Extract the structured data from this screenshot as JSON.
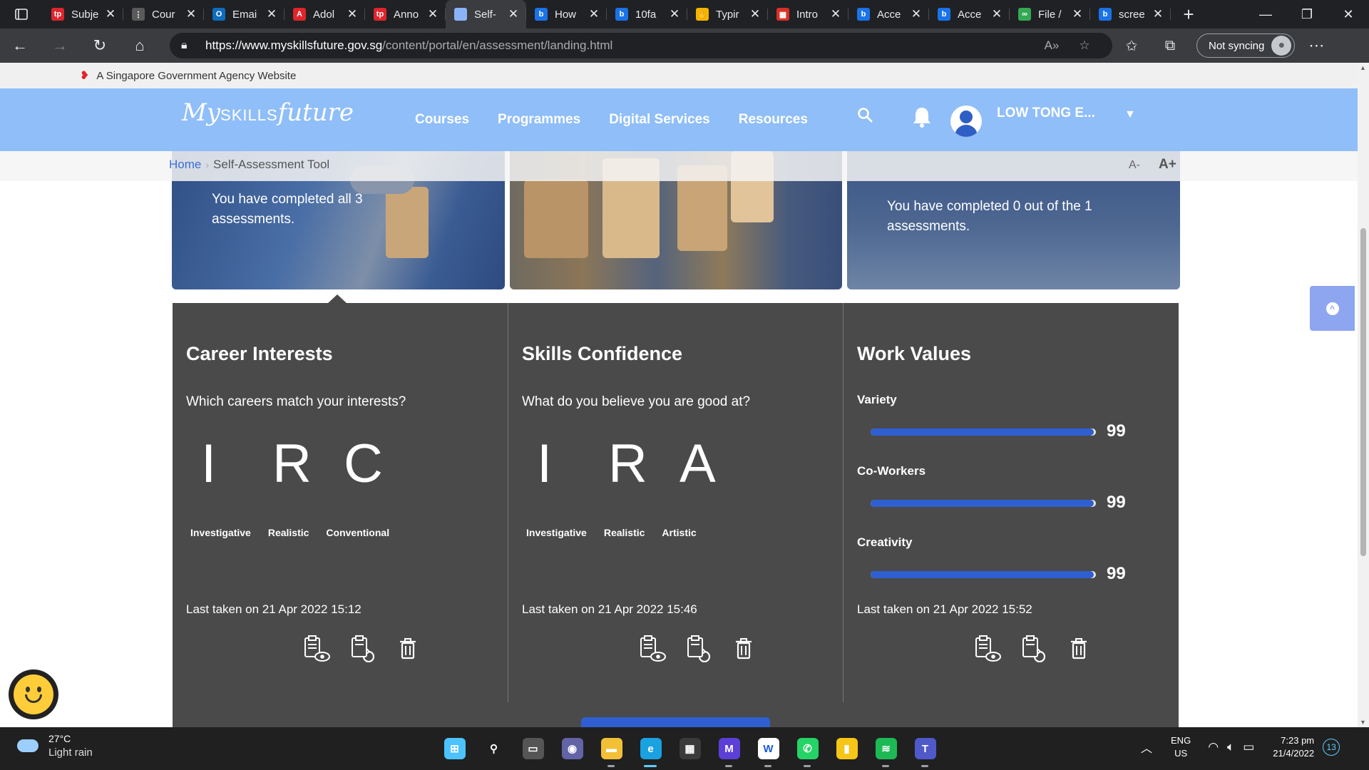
{
  "browser": {
    "tabs": [
      {
        "title": "Subje",
        "icon": "tp-icon",
        "color": "#e0242c",
        "glyph": "tp"
      },
      {
        "title": "Cour",
        "icon": "cisco-icon",
        "color": "#5a5a5a",
        "glyph": "⋮"
      },
      {
        "title": "Emai",
        "icon": "outlook-icon",
        "color": "#0f6cbd",
        "glyph": "O"
      },
      {
        "title": "Adol",
        "icon": "adobe-icon",
        "color": "#e0242c",
        "glyph": "A"
      },
      {
        "title": "Anno",
        "icon": "tp-icon",
        "color": "#e0242c",
        "glyph": "tp"
      },
      {
        "title": "Self-",
        "icon": "page-icon",
        "color": "#8ab4f8",
        "glyph": ""
      },
      {
        "title": "How",
        "icon": "bing-icon",
        "color": "#1a73e8",
        "glyph": "b"
      },
      {
        "title": "10fa",
        "icon": "bing-icon",
        "color": "#1a73e8",
        "glyph": "b"
      },
      {
        "title": "Typir",
        "icon": "typing-icon",
        "color": "#f4b400",
        "glyph": "✋"
      },
      {
        "title": "Intro",
        "icon": "cisco-icon",
        "color": "#d93025",
        "glyph": "▦"
      },
      {
        "title": "Acce",
        "icon": "bing-icon",
        "color": "#1a73e8",
        "glyph": "b"
      },
      {
        "title": "Acce",
        "icon": "bing-icon",
        "color": "#1a73e8",
        "glyph": "b"
      },
      {
        "title": "File /",
        "icon": "link-icon",
        "color": "#34a853",
        "glyph": "∞"
      },
      {
        "title": "scree",
        "icon": "bing-icon",
        "color": "#1a73e8",
        "glyph": "b"
      }
    ],
    "url_domain": "https://www.myskillsfuture.gov.sg",
    "url_path": "/content/portal/en/assessment/landing.html",
    "sync_label": "Not syncing"
  },
  "gov_banner": "A Singapore Government Agency Website",
  "header": {
    "logo_my": "My",
    "logo_skills": "SKILLS",
    "logo_future": "future",
    "nav": [
      "Courses",
      "Programmes",
      "Digital Services",
      "Resources"
    ],
    "user_name": "LOW TONG E..."
  },
  "breadcrumb": {
    "home": "Home",
    "current": "Self-Assessment Tool"
  },
  "font_controls": {
    "decrease": "A-",
    "increase": "A+"
  },
  "heroes": {
    "card1": "You have completed all 3 assessments.",
    "card3": "You have completed 0 out of the 1 assessments."
  },
  "assessments": {
    "career": {
      "title": "Career Interests",
      "question": "Which careers match your interests?",
      "letters": [
        "I",
        "R",
        "C"
      ],
      "traits": [
        "Investigative",
        "Realistic",
        "Conventional"
      ],
      "last_taken": "Last taken on 21 Apr 2022 15:12"
    },
    "skills": {
      "title": "Skills Confidence",
      "question": "What do you believe you are good at?",
      "letters": [
        "I",
        "R",
        "A"
      ],
      "traits": [
        "Investigative",
        "Realistic",
        "Artistic"
      ],
      "last_taken": "Last taken on 21 Apr 2022 15:46"
    },
    "values": {
      "title": "Work Values",
      "items": [
        {
          "label": "Variety",
          "score": "99",
          "fraction": 0.99
        },
        {
          "label": "Co-Workers",
          "score": "99",
          "fraction": 0.99
        },
        {
          "label": "Creativity",
          "score": "99",
          "fraction": 0.99
        }
      ],
      "last_taken": "Last taken on 21 Apr 2022 15:52"
    }
  },
  "colors": {
    "header_blue": "#8fbef8",
    "panel_bg": "#4a4a4a",
    "bar_fill": "#2f5fd0"
  },
  "taskbar": {
    "weather_temp": "27°C",
    "weather_desc": "Light rain",
    "lang_1": "ENG",
    "lang_2": "US",
    "time": "7:23 pm",
    "date": "21/4/2022",
    "notifications": "13",
    "apps": [
      {
        "name": "start-icon",
        "color": "#4cc2ff",
        "glyph": "⊞"
      },
      {
        "name": "search-icon",
        "color": "transparent",
        "glyph": "⚲"
      },
      {
        "name": "task-view-icon",
        "color": "#555",
        "glyph": "▭"
      },
      {
        "name": "teams-chat-icon",
        "color": "#6264a7",
        "glyph": "◉"
      },
      {
        "name": "file-explorer-icon",
        "color": "#f2c037",
        "glyph": "▬"
      },
      {
        "name": "edge-icon",
        "color": "#1aa1e0",
        "glyph": "e"
      },
      {
        "name": "store-icon",
        "color": "#3a3a3a",
        "glyph": "▦"
      },
      {
        "name": "vscode-insiders-icon",
        "color": "#5b3fd6",
        "glyph": "M"
      },
      {
        "name": "word-icon",
        "color": "#ffffff",
        "glyph": "W"
      },
      {
        "name": "whatsapp-icon",
        "color": "#25d366",
        "glyph": "✆"
      },
      {
        "name": "sticky-icon",
        "color": "#f5c518",
        "glyph": "▮"
      },
      {
        "name": "spotify-icon",
        "color": "#1db954",
        "glyph": "≋"
      },
      {
        "name": "teams-icon",
        "color": "#5059c9",
        "glyph": "T"
      }
    ]
  }
}
